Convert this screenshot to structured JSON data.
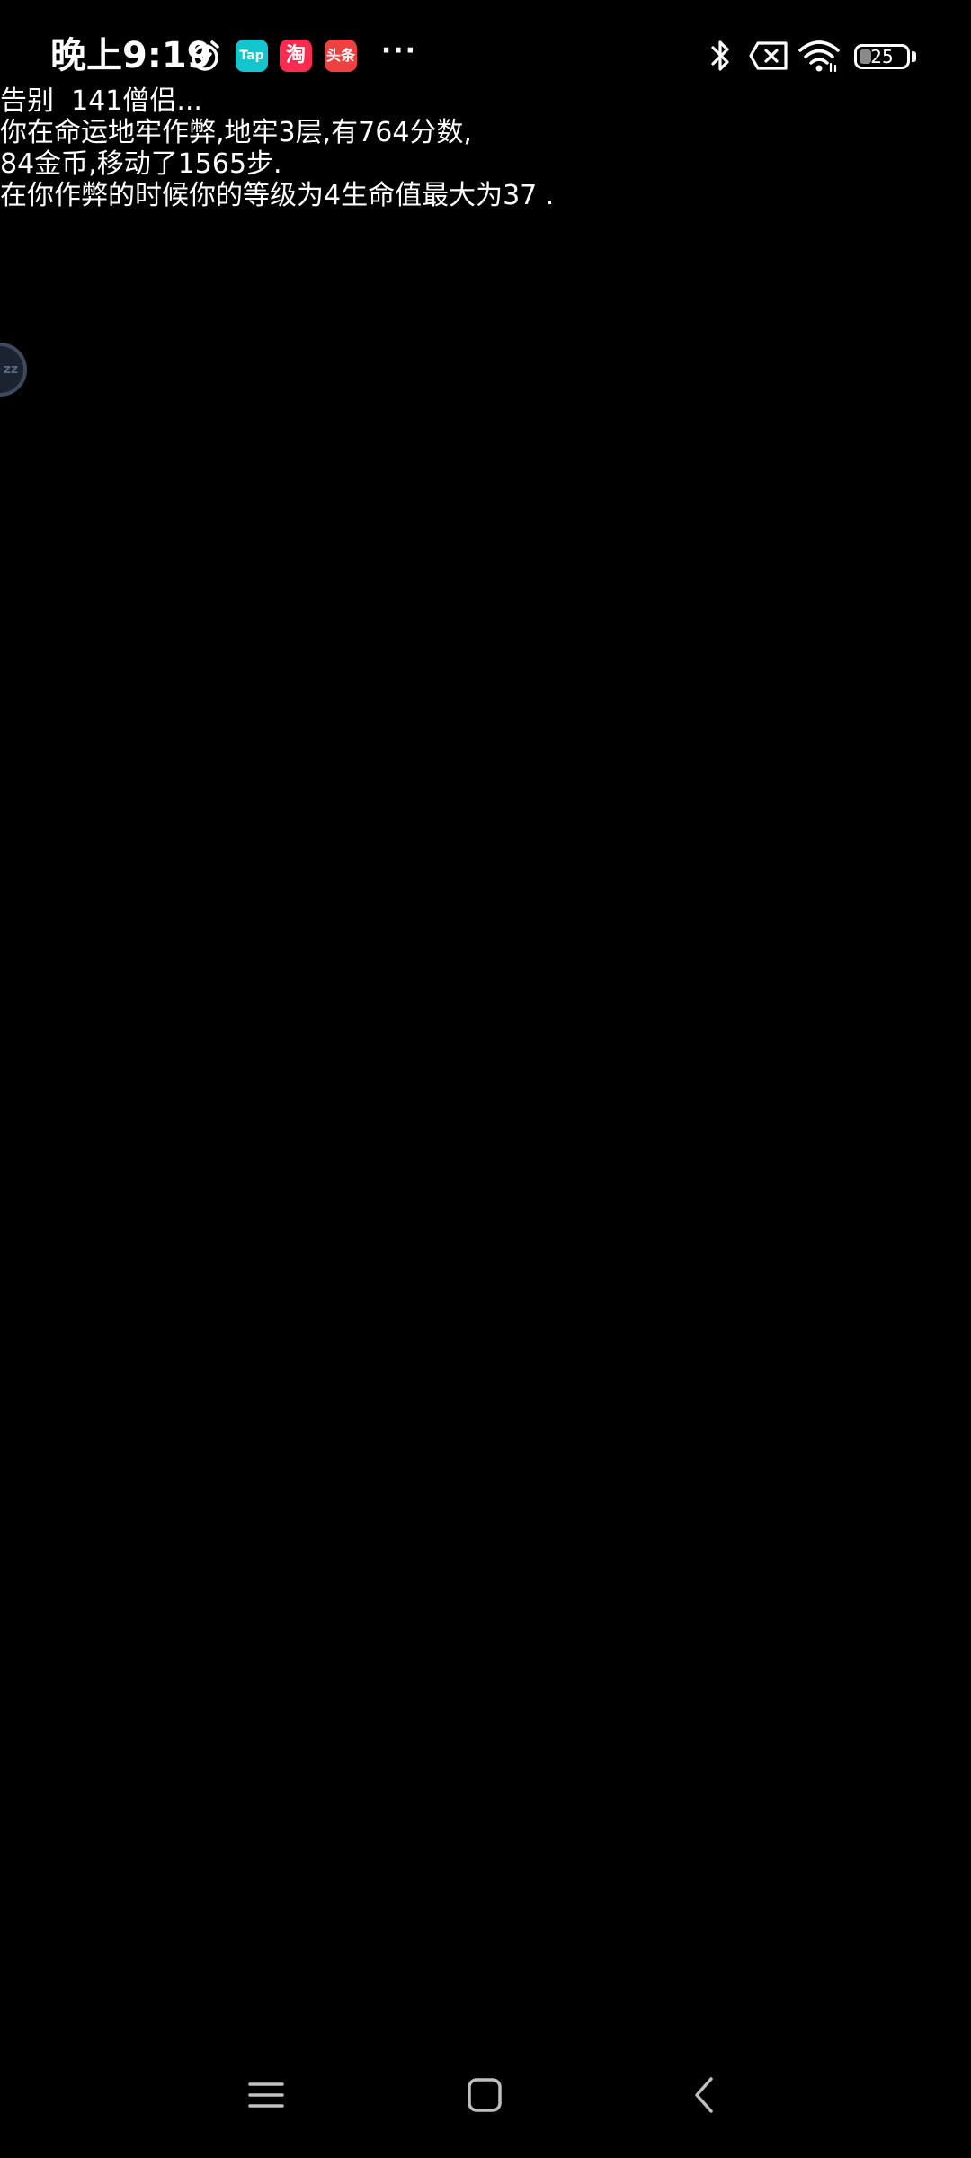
{
  "status_bar": {
    "time": "晚上9:19",
    "apps": [
      {
        "name": "tap-app-icon",
        "label": "Tap",
        "color": "#15c5ce"
      },
      {
        "name": "taobao-app-icon",
        "label": "淘",
        "color": "#ff2a4f"
      },
      {
        "name": "toutiao-app-icon",
        "label": "头条",
        "color": "#f04142"
      }
    ],
    "more": "···",
    "battery": {
      "level_percent": 25,
      "label": "25"
    }
  },
  "game_text": {
    "lines": [
      "告别  141僧侣...",
      "你在命运地牢作弊,地牢3层,有764分数,",
      "84金币,移动了1565步.",
      "在你作弊的时候你的等级为4生命值最大为37 ."
    ]
  },
  "float_bubble": {
    "label": "zz"
  },
  "nav_bar": {
    "buttons": [
      "menu",
      "home",
      "back"
    ]
  },
  "colors": {
    "background": "#000000",
    "text": "#ffffff"
  }
}
